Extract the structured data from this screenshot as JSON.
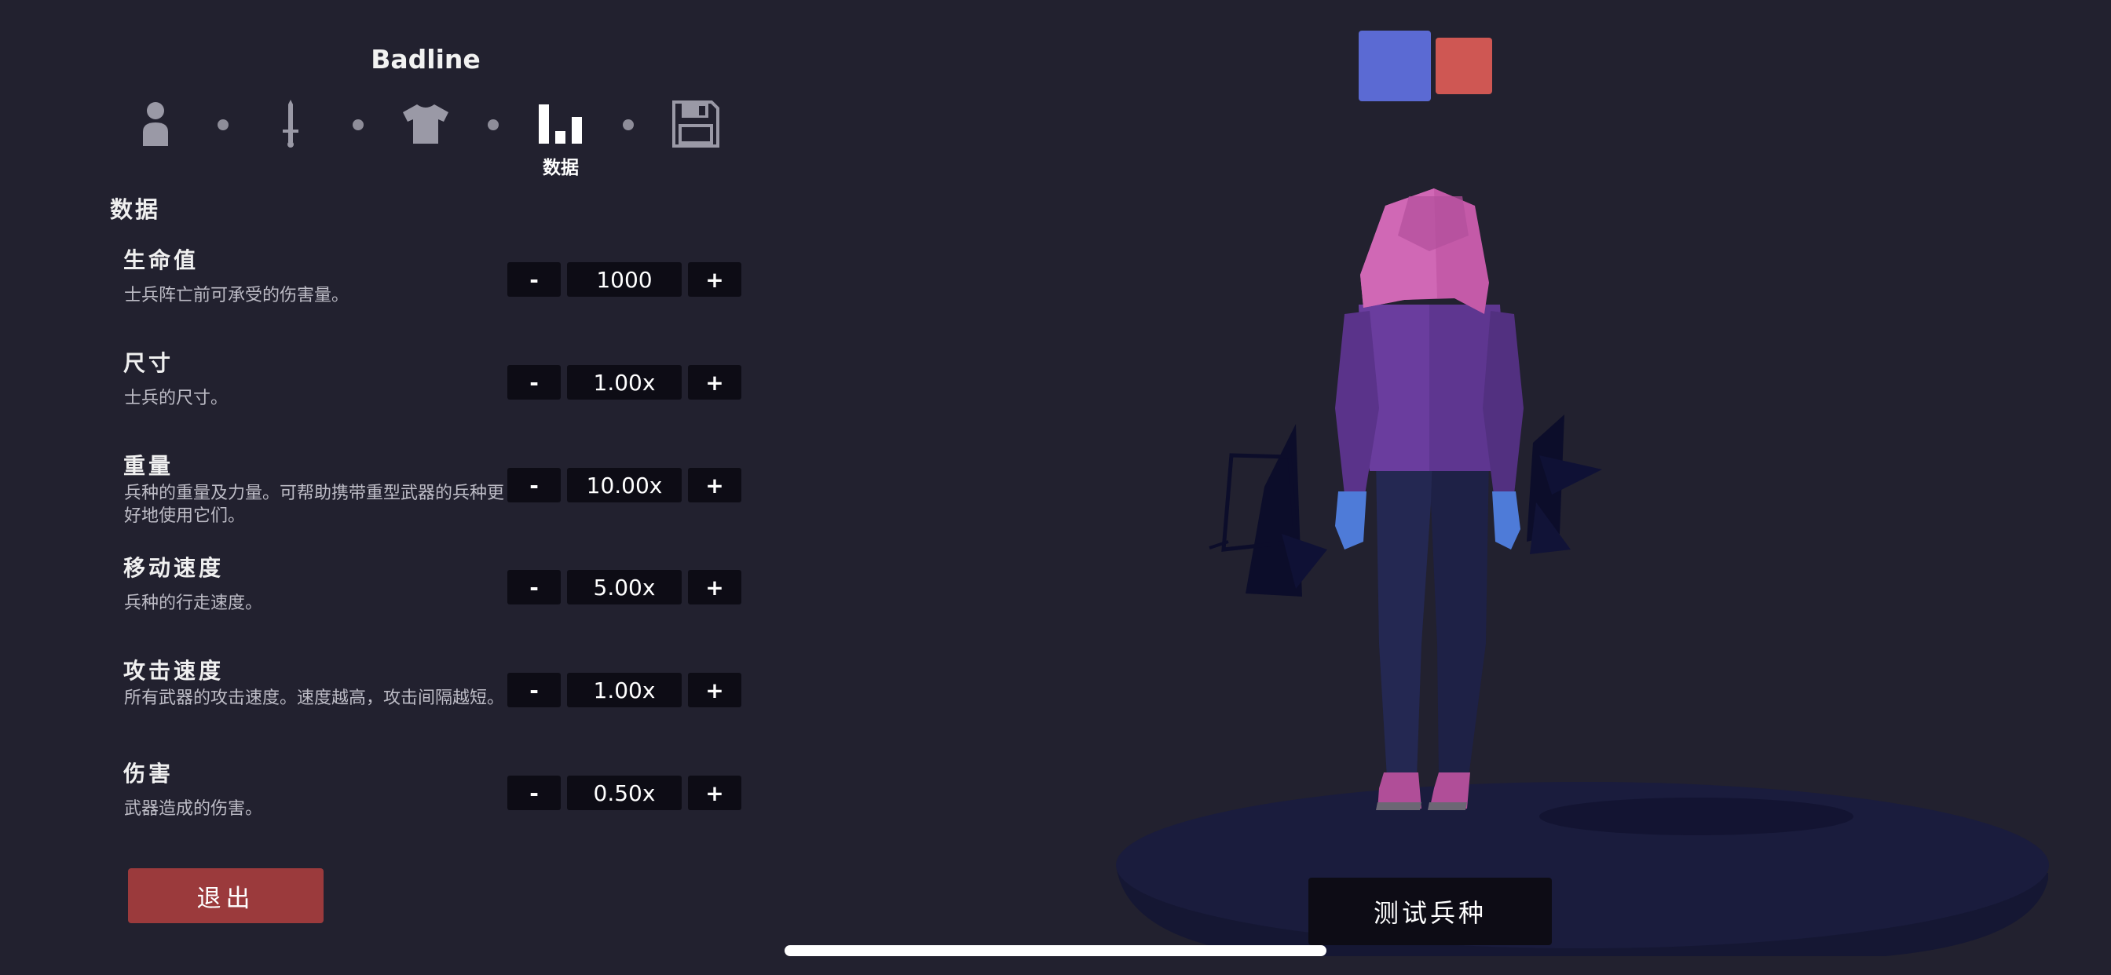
{
  "unit": {
    "name": "Badline"
  },
  "steps": [
    {
      "icon": "person-icon"
    },
    {
      "icon": "sword-icon"
    },
    {
      "icon": "shirt-icon"
    },
    {
      "icon": "stats-icon",
      "label": "数据",
      "active": true
    },
    {
      "icon": "save-icon"
    }
  ],
  "section": {
    "title": "数据"
  },
  "stats": [
    {
      "title": "生命值",
      "desc": "士兵阵亡前可承受的伤害量。",
      "value": "1000"
    },
    {
      "title": "尺寸",
      "desc": "士兵的尺寸。",
      "value": "1.00x"
    },
    {
      "title": "重量",
      "desc": "兵种的重量及力量。可帮助携带重型武器的兵种更好地使用它们。",
      "value": "10.00x"
    },
    {
      "title": "移动速度",
      "desc": "兵种的行走速度。",
      "value": "5.00x"
    },
    {
      "title": "攻击速度",
      "desc": "所有武器的攻击速度。速度越高，攻击间隔越短。",
      "value": "1.00x"
    },
    {
      "title": "伤害",
      "desc": "武器造成的伤害。",
      "value": "0.50x"
    }
  ],
  "controls": {
    "minus": "-",
    "plus": "+"
  },
  "actions": {
    "exit_label": "退出",
    "test_label": "测试兵种"
  },
  "teams": {
    "blue_color": "#5b6ad3",
    "red_color": "#cf5753",
    "selected": "blue"
  },
  "colors": {
    "background": "#22212f",
    "control_bg": "#0d0c15",
    "exit_button": "#9b3a3c",
    "character_hair": "#c45aa8",
    "character_jacket": "#5e3690",
    "character_pants": "#1e2146",
    "character_gloves": "#4e7bd8",
    "platform": "#1a1c3d"
  }
}
